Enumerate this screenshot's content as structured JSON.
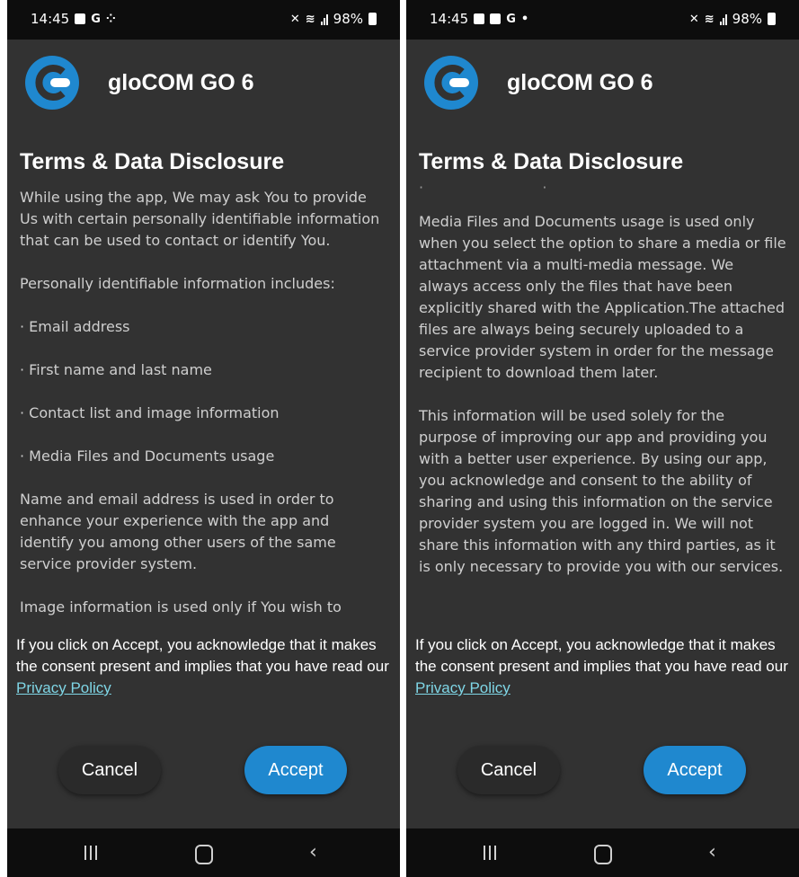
{
  "left_screen": {
    "status": {
      "time": "14:45",
      "icons": [
        "mail-icon",
        "google-icon",
        "dots-icon"
      ],
      "battery": "98%"
    },
    "app_title": "gloCOM GO 6",
    "terms_title": "Terms & Data Disclosure",
    "paragraphs": [
      "While using the app, We may ask You to provide Us with certain personally identifiable information that can be used to contact or identify You.",
      "Personally identifiable information includes:",
      "· Email address",
      "· First name and last name",
      "· Contact list and image information",
      "· Media Files and Documents usage",
      "Name and email address is used in order to enhance your experience with the app and identify you among other users of the same service provider system.",
      "Image information is used only if You wish to"
    ],
    "consent_text": "If you click on Accept, you acknowledge that it makes the consent present and implies that you have read our",
    "privacy_link": "Privacy Policy",
    "cancel_label": "Cancel",
    "accept_label": "Accept"
  },
  "right_screen": {
    "status": {
      "time": "14:45",
      "icons": [
        "image-icon",
        "mail-icon",
        "google-icon",
        "dot-icon"
      ],
      "battery": "98%"
    },
    "app_title": "gloCOM GO 6",
    "terms_title": "Terms & Data Disclosure",
    "paragraphs": [
      "Media Files and Documents usage is used only when you select the option to share a media or file attachment via a multi-media message. We always access only the files that have been explicitly shared with the Application.The attached files are always being securely uploaded to a service provider system in order for the message recipient to download them later.",
      "This information will be used solely for the purpose of improving our app and providing you with a better user experience. By using our app, you acknowledge and consent to the ability of sharing and using this information on the service provider system you are logged in. We will not share this information with any third parties, as it is only necessary to provide you with our services."
    ],
    "consent_text": "If you click on Accept, you acknowledge that it makes the consent present and implies that you have read our",
    "privacy_link": "Privacy Policy",
    "cancel_label": "Cancel",
    "accept_label": "Accept"
  },
  "colors": {
    "background": "#323232",
    "status_bar": "#0d0d0d",
    "accent": "#1f88cf",
    "link": "#7fd6e6"
  }
}
